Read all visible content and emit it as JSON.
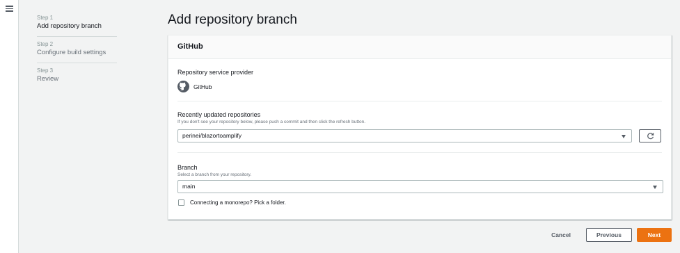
{
  "wizard": {
    "steps": [
      {
        "num": "Step 1",
        "title": "Add repository branch"
      },
      {
        "num": "Step 2",
        "title": "Configure build settings"
      },
      {
        "num": "Step 3",
        "title": "Review"
      }
    ],
    "active_step": 0
  },
  "page": {
    "title": "Add repository branch"
  },
  "panel": {
    "header": "GitHub",
    "provider": {
      "label": "Repository service provider",
      "value": "GitHub",
      "icon": "github-icon"
    },
    "repositories": {
      "label": "Recently updated repositories",
      "description": "If you don't see your repository below, please push a commit and then click the refresh button.",
      "selected": "perinei/blazortoamplify",
      "refresh_icon": "refresh-icon"
    },
    "branch": {
      "label": "Branch",
      "description": "Select a branch from your repository.",
      "selected": "main"
    },
    "monorepo": {
      "label": "Connecting a monorepo? Pick a folder.",
      "checked": false
    }
  },
  "footer": {
    "cancel": "Cancel",
    "previous": "Previous",
    "next": "Next"
  },
  "colors": {
    "accent": "#ec7211",
    "background": "#f2f3f3"
  }
}
